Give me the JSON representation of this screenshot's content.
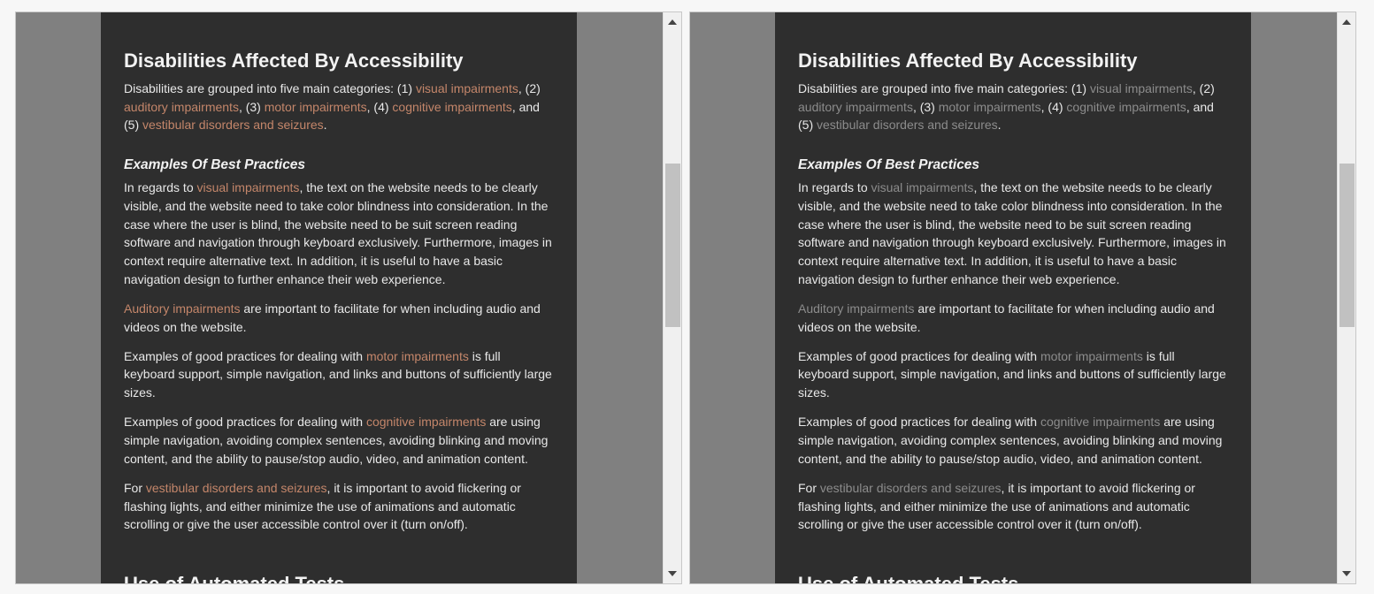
{
  "colors": {
    "left_link": "#c4866a",
    "right_link": "#8c8c8c",
    "background": "#2e2e2e",
    "text": "#e8e8e8"
  },
  "article": {
    "heading": "Disabilities Affected By Accessibility",
    "intro": [
      "Disabilities are grouped into five main categories: (1) ",
      "visual impairments",
      ", (2) ",
      "auditory impairments",
      ", (3) ",
      "motor impairments",
      ", (4) ",
      "cognitive impairments",
      ", and (5) ",
      "vestibular disorders and seizures",
      "."
    ],
    "subheading": "Examples Of Best Practices",
    "visual": [
      "In regards to ",
      "visual impairments",
      ", the text on the website needs to be clearly visible, and the website need to take color blindness into consideration. In the case where the user is blind, the website need to be suit screen reading software and navigation through keyboard exclusively. Furthermore, images in context require alternative text. In addition, it is useful to have a basic navigation design to further enhance their web experience."
    ],
    "auditory": [
      "Auditory impairments",
      " are important to facilitate for when including audio and videos on the website."
    ],
    "motor": [
      "Examples of good practices for dealing with ",
      "motor impairments",
      " is full keyboard support, simple navigation, and links and buttons of sufficiently large sizes."
    ],
    "cognitive": [
      "Examples of good practices for dealing with ",
      "cognitive impairments",
      " are using simple navigation, avoiding complex sentences, avoiding blinking and moving content, and the ability to pause/stop audio, video, and animation content."
    ],
    "vestibular": [
      "For ",
      "vestibular disorders and seizures",
      ", it is important to avoid flickering or flashing lights, and either minimize the use of animations and automatic scrolling or give the user accessible control over it (turn on/off)."
    ],
    "next_heading": "Use of Automated Tests"
  }
}
